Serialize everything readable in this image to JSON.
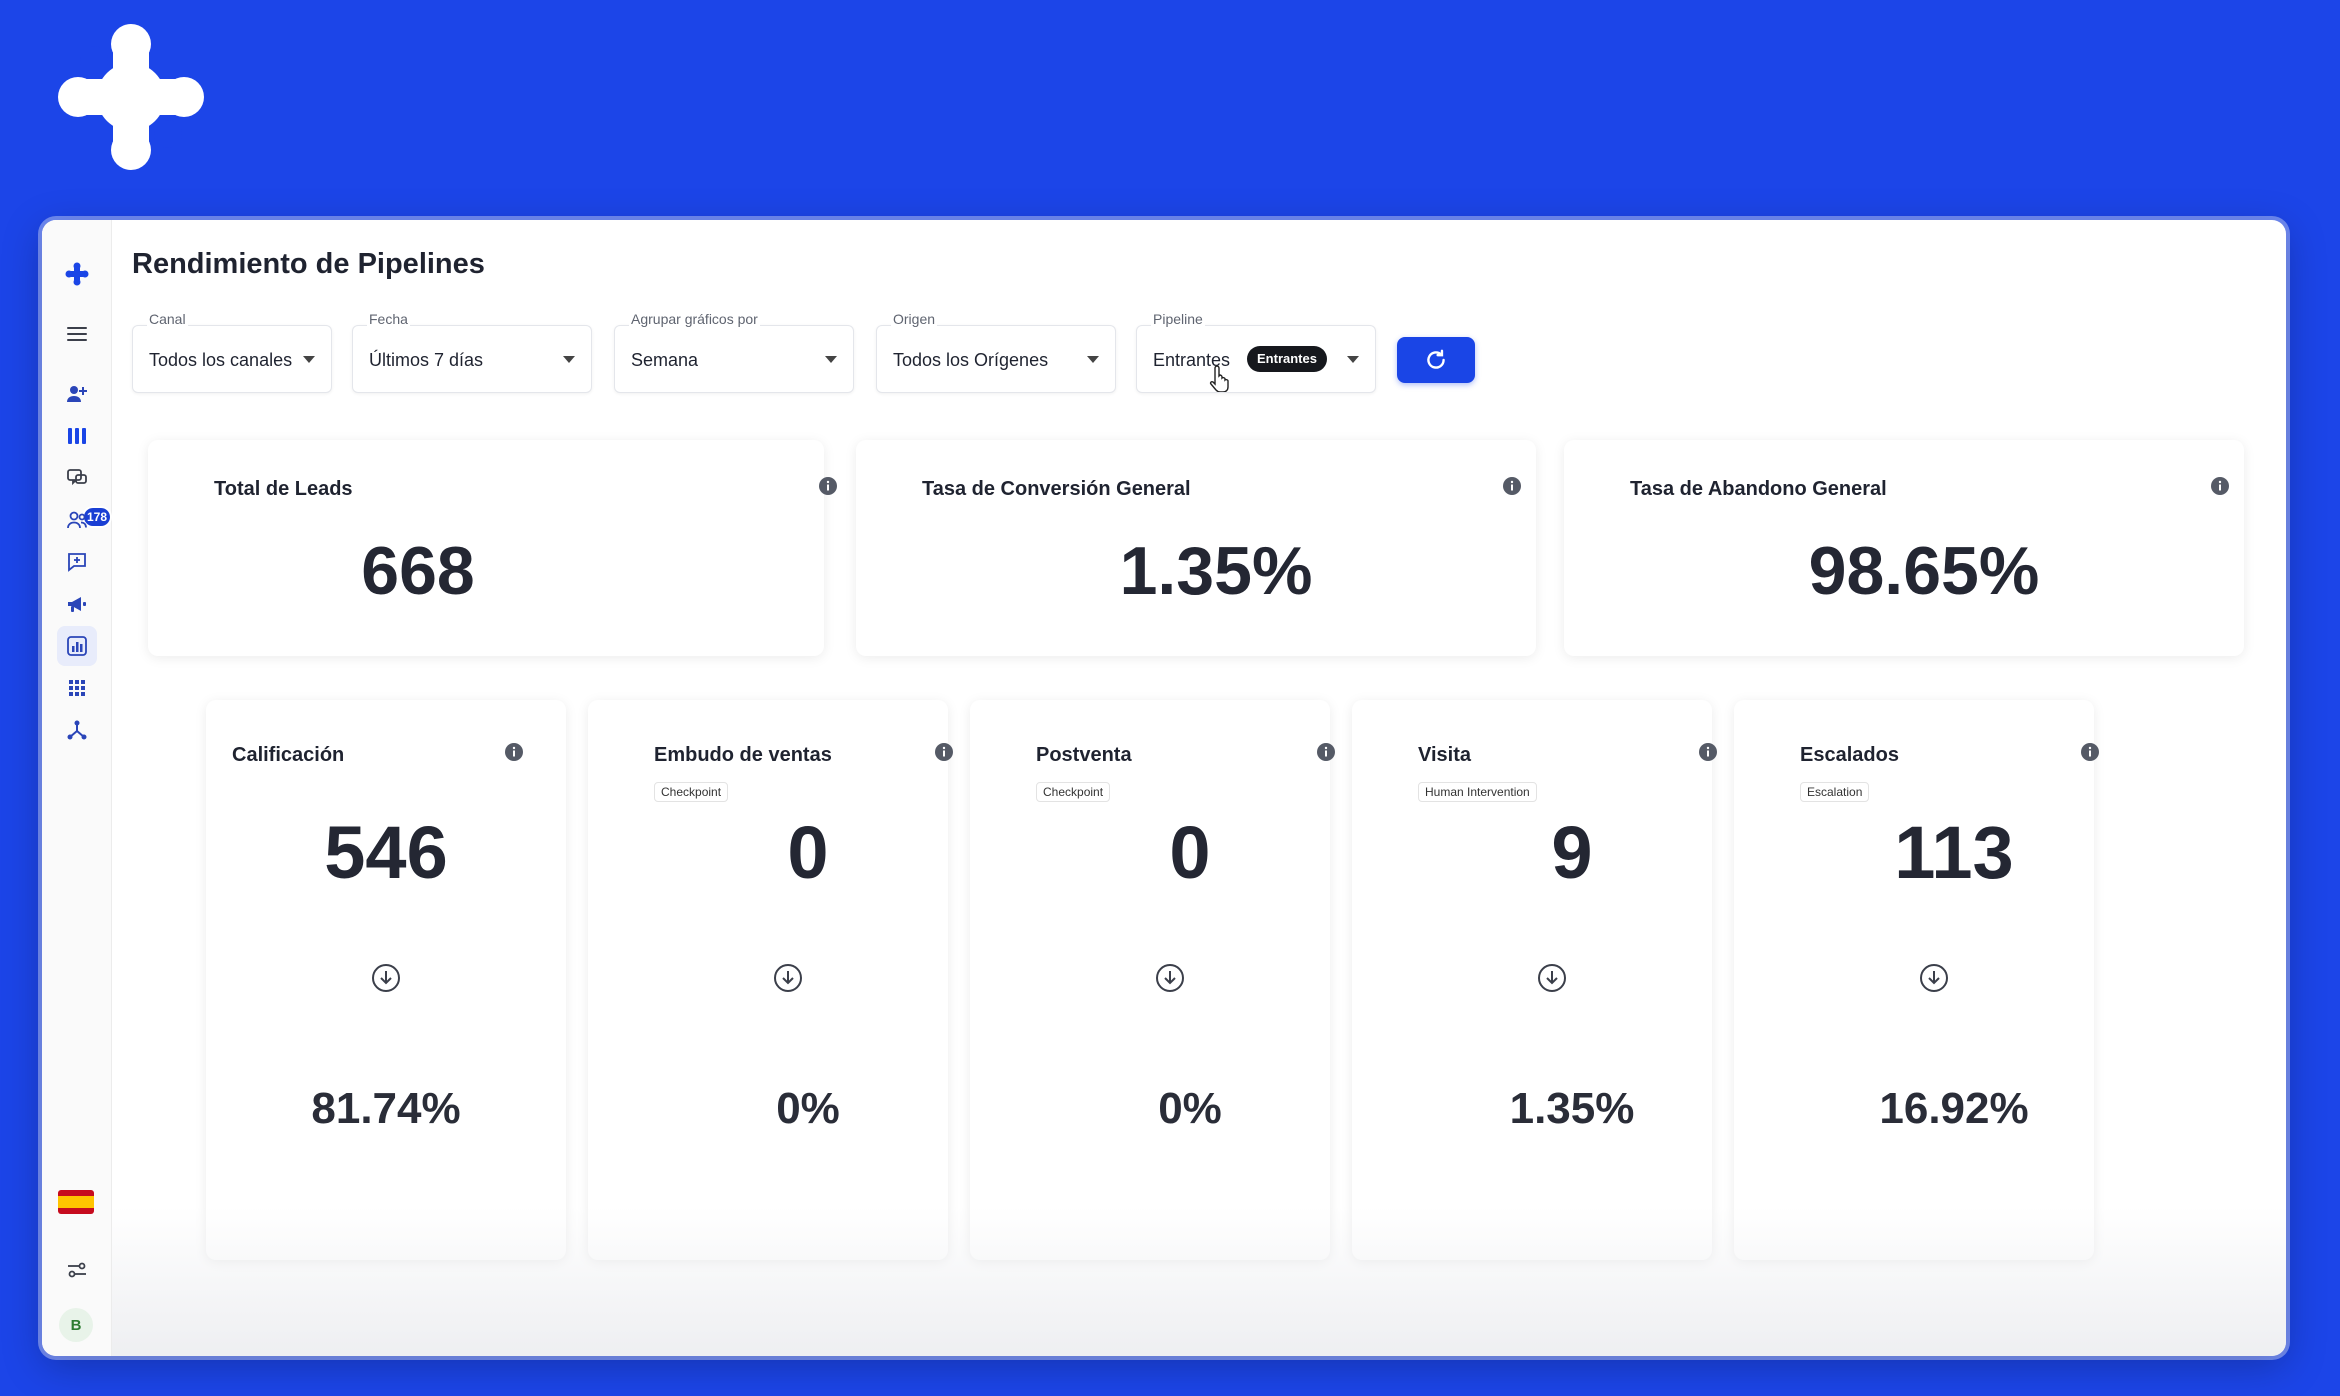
{
  "brand": {
    "logo_icon": "sparkle-blob-logo"
  },
  "sidebar": {
    "badge": "178",
    "items": [
      {
        "icon": "logo-mark-icon"
      },
      {
        "icon": "menu-icon"
      },
      {
        "icon": "user-add-icon"
      },
      {
        "icon": "kanban-icon"
      },
      {
        "icon": "chat-icon"
      },
      {
        "icon": "users-icon"
      },
      {
        "icon": "message-plus-icon"
      },
      {
        "icon": "megaphone-icon"
      },
      {
        "icon": "analytics-icon"
      },
      {
        "icon": "apps-grid-icon"
      },
      {
        "icon": "flow-icon"
      }
    ],
    "language_flag": "spain-flag-icon",
    "settings_icon": "sliders-icon",
    "avatar_initial": "B"
  },
  "header": {
    "title": "Rendimiento de Pipelines"
  },
  "filters": {
    "canal": {
      "label": "Canal",
      "value": "Todos los canales"
    },
    "fecha": {
      "label": "Fecha",
      "value": "Últimos 7 días"
    },
    "agrupar": {
      "label": "Agrupar gráficos por",
      "value": "Semana"
    },
    "origen": {
      "label": "Origen",
      "value": "Todos los Orígenes"
    },
    "pipeline": {
      "label": "Pipeline",
      "value": "Entrantes",
      "tag": "Entrantes"
    }
  },
  "summary": {
    "total_leads": {
      "title": "Total de Leads",
      "value": "668"
    },
    "conversion": {
      "title": "Tasa de Conversión General",
      "value": "1.35%"
    },
    "abandono": {
      "title": "Tasa de Abandono General",
      "value": "98.65%"
    }
  },
  "stages": [
    {
      "title": "Calificación",
      "chip": "",
      "value": "546",
      "percent": "81.74%"
    },
    {
      "title": "Embudo de ventas",
      "chip": "Checkpoint",
      "value": "0",
      "percent": "0%"
    },
    {
      "title": "Postventa",
      "chip": "Checkpoint",
      "value": "0",
      "percent": "0%"
    },
    {
      "title": "Visita",
      "chip": "Human Intervention",
      "value": "9",
      "percent": "1.35%"
    },
    {
      "title": "Escalados",
      "chip": "Escalation",
      "value": "113",
      "percent": "16.92%"
    }
  ],
  "colors": {
    "background": "#1c45e8",
    "accent": "#1a45e6",
    "badge": "#1a3fd4"
  }
}
